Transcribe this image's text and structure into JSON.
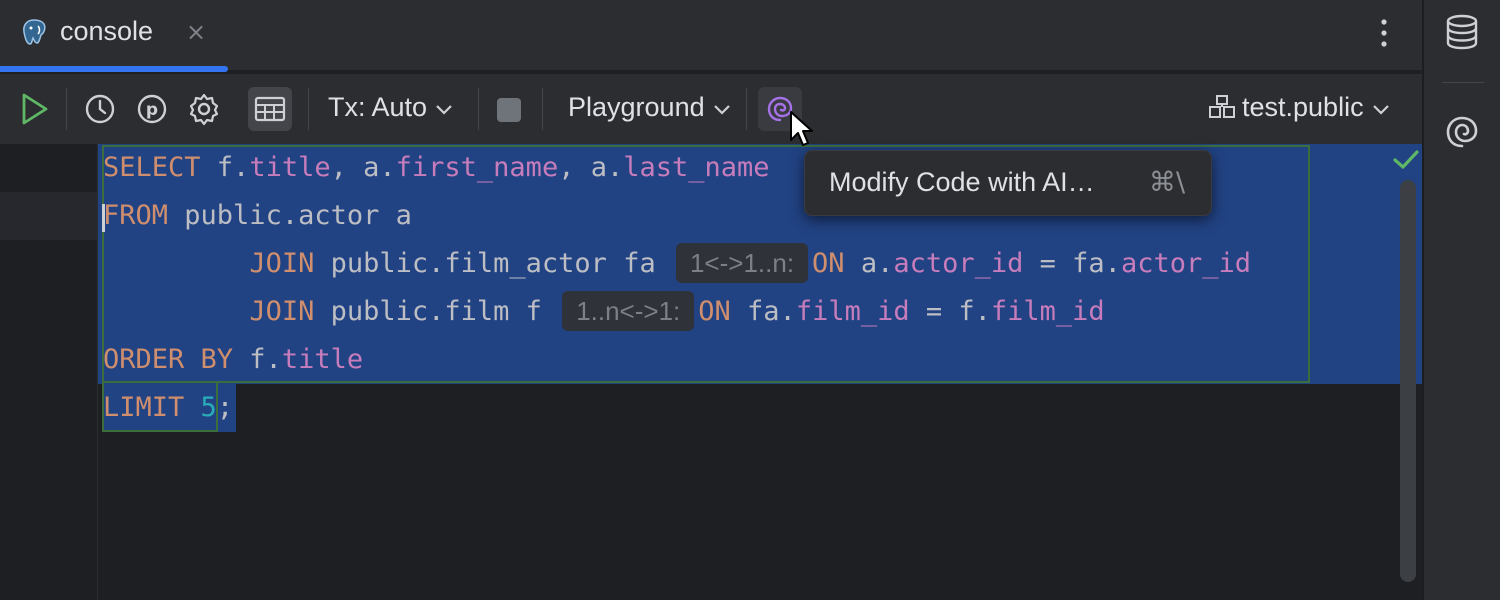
{
  "tab": {
    "title": "console",
    "close": "×"
  },
  "toolbar": {
    "tx_label": "Tx: Auto",
    "playground_label": "Playground",
    "schema_label": "test.public"
  },
  "editor": {
    "line1": {
      "kw1": "SELECT",
      "t1": " f.",
      "f1": "title",
      "t2": ", a.",
      "f2": "first_name",
      "t3": ", a.",
      "f3": "last_name"
    },
    "line2": {
      "kw": "FROM",
      "t": " public.actor a"
    },
    "line3": {
      "indent": "         ",
      "kw": "JOIN",
      "t1": " public.film_actor fa ",
      "hint": "1<->1..n:",
      "kw2": "ON",
      "t2": " a.",
      "f1": "actor_id",
      "t3": " = fa.",
      "f2": "actor_id"
    },
    "line4": {
      "indent": "         ",
      "kw": "JOIN",
      "t1": " public.film f ",
      "hint": "1..n<->1:",
      "kw2": "ON",
      "t2": " fa.",
      "f1": "film_id",
      "t3": " = f.",
      "f2": "film_id"
    },
    "line5": {
      "kw": "ORDER BY",
      "t": " f.",
      "f": "title"
    },
    "line6": {
      "kw": "LIMIT",
      "sp": " ",
      "num": "5",
      "t": ";"
    }
  },
  "tooltip": {
    "text": "Modify Code with AI…",
    "shortcut": "⌘\\"
  },
  "colors": {
    "accent": "#3574f0",
    "keyword": "#cf8e6d",
    "field": "#c77dbb",
    "number": "#2aacb8",
    "selection": "#214283",
    "ai_purple": "#a571e6"
  },
  "icons": [
    "postgresql-icon",
    "close-icon",
    "more-vertical-icon",
    "run-icon",
    "history-icon",
    "parameters-icon",
    "settings-icon",
    "table-grid-icon",
    "chevron-down-icon",
    "stop-icon",
    "ai-assistant-icon",
    "schema-icon",
    "database-icon",
    "check-icon",
    "mouse-cursor-icon"
  ]
}
